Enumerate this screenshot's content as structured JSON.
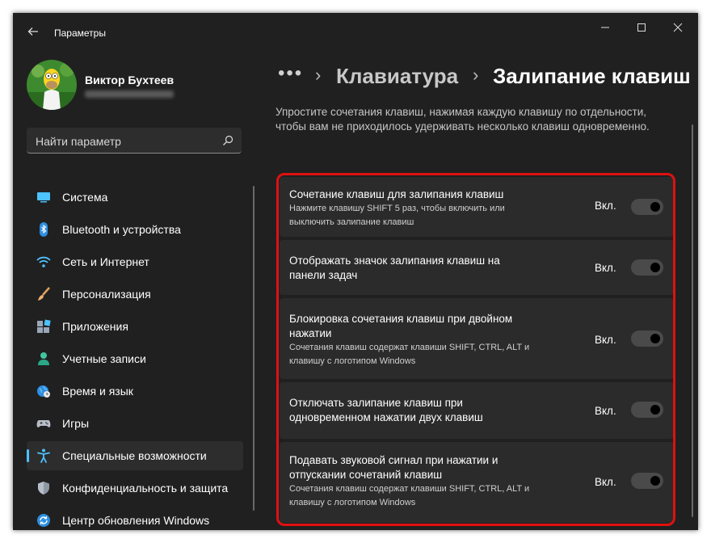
{
  "window": {
    "title": "Параметры"
  },
  "user": {
    "name": "Виктор Бухтеев"
  },
  "search": {
    "placeholder": "Найти параметр"
  },
  "nav": [
    {
      "label": "Система",
      "icon": "system-icon"
    },
    {
      "label": "Bluetooth и устройства",
      "icon": "bluetooth-icon"
    },
    {
      "label": "Сеть и Интернет",
      "icon": "network-icon"
    },
    {
      "label": "Персонализация",
      "icon": "brush-icon"
    },
    {
      "label": "Приложения",
      "icon": "apps-icon"
    },
    {
      "label": "Учетные записи",
      "icon": "account-icon"
    },
    {
      "label": "Время и язык",
      "icon": "globe-clock-icon"
    },
    {
      "label": "Игры",
      "icon": "gamepad-icon"
    },
    {
      "label": "Специальные возможности",
      "icon": "accessibility-icon",
      "active": true
    },
    {
      "label": "Конфиденциальность и защита",
      "icon": "shield-icon"
    },
    {
      "label": "Центр обновления Windows",
      "icon": "update-icon"
    }
  ],
  "breadcrumb": {
    "more": "•••",
    "parent": "Клавиатура",
    "current": "Залипание клавиш"
  },
  "description": "Упростите сочетания клавиш, нажимая каждую клавишу по отдельности, чтобы вам не приходилось удерживать несколько клавиш одновременно.",
  "settings": [
    {
      "title": "Сочетание клавиш для залипания клавиш",
      "subtitle": "Нажмите клавишу SHIFT 5 раз, чтобы включить или выключить залипание клавиш",
      "state": "Вкл.",
      "on": true
    },
    {
      "title": "Отображать значок залипания клавиш на панели задач",
      "subtitle": "",
      "state": "Вкл.",
      "on": true
    },
    {
      "title": "Блокировка сочетания клавиш при двойном нажатии",
      "subtitle": "Сочетания клавиш содержат клавиши SHIFT, CTRL, ALT и клавишу с логотипом Windows",
      "state": "Вкл.",
      "on": true
    },
    {
      "title": "Отключать залипание клавиш при одновременном нажатии двух клавиш",
      "subtitle": "",
      "state": "Вкл.",
      "on": true
    },
    {
      "title": "Подавать звуковой сигнал при нажатии и отпускании сочетаний клавиш",
      "subtitle": "Сочетания клавиш содержат клавиши SHIFT, CTRL, ALT и клавишу с логотипом Windows",
      "state": "Вкл.",
      "on": true
    }
  ],
  "colors": {
    "accent": "#4cc2ff",
    "highlight": "#e01010",
    "background": "#202020",
    "card": "#2b2b2b"
  }
}
